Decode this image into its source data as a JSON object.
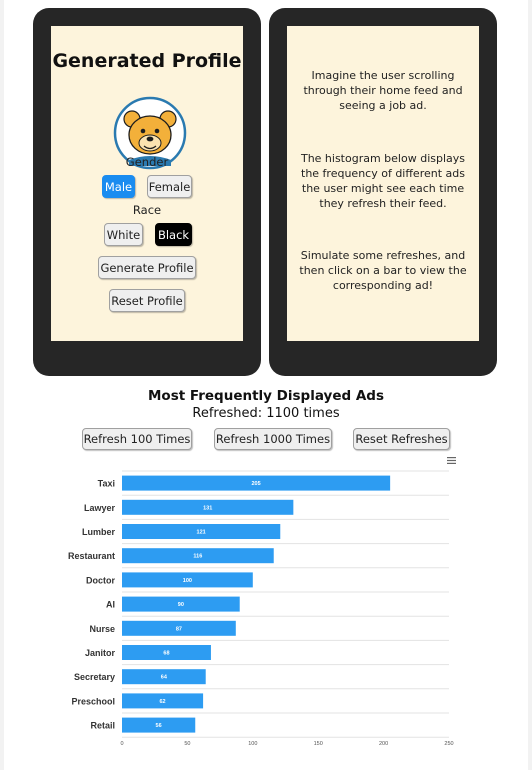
{
  "profile": {
    "title": "Generated Profile",
    "gender_label": "Gender",
    "gender_options": [
      "Male",
      "Female"
    ],
    "gender_selected": "Male",
    "race_label": "Race",
    "race_options": [
      "White",
      "Black"
    ],
    "race_selected": "Black",
    "generate_button": "Generate Profile",
    "reset_button": "Reset Profile"
  },
  "instructions": {
    "p1": "Imagine the user scrolling through their home feed and seeing a job ad.",
    "p2": "The histogram below displays the frequency of different ads the user might see each time they refresh their feed.",
    "p3": "Simulate some refreshes, and then click on a bar to view the corresponding ad!"
  },
  "chart_section": {
    "title": "Most Frequently Displayed Ads",
    "refreshed_text": "Refreshed: 1100 times",
    "buttons": [
      "Refresh 100 Times",
      "Refresh 1000 Times",
      "Reset Refreshes"
    ]
  },
  "colors": {
    "accent": "#1a8cf0",
    "bar": "#2d9cf2",
    "phone": "#262626",
    "screen": "#fdf4dc"
  },
  "chart_data": {
    "type": "bar",
    "orientation": "horizontal",
    "categories": [
      "Taxi",
      "Lawyer",
      "Lumber",
      "Restaurant",
      "Doctor",
      "AI",
      "Nurse",
      "Janitor",
      "Secretary",
      "Preschool",
      "Retail"
    ],
    "values": [
      205,
      131,
      121,
      116,
      100,
      90,
      87,
      68,
      64,
      62,
      56
    ],
    "xlim": [
      0,
      250
    ],
    "xticks": [
      0,
      50,
      100,
      150,
      200,
      250
    ],
    "grid": true,
    "legend": false
  }
}
